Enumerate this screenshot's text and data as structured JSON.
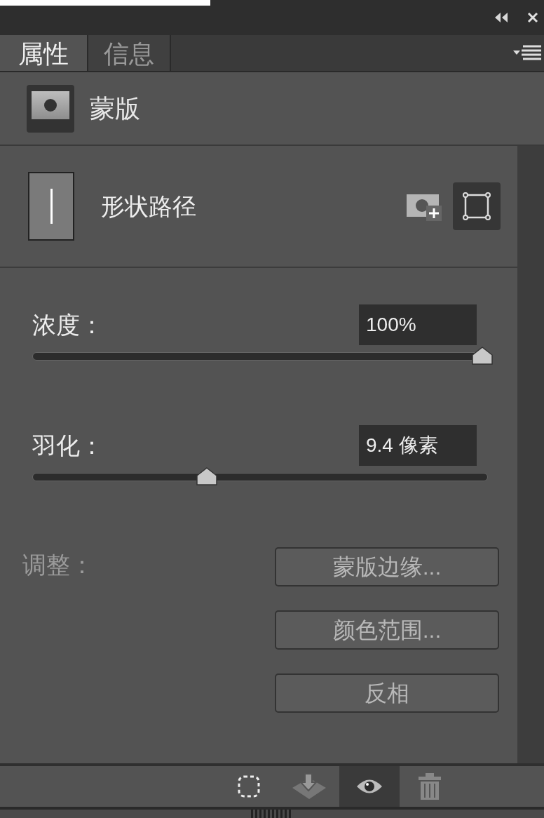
{
  "tabs": [
    {
      "label": "属性",
      "selected": true
    },
    {
      "label": "信息",
      "selected": false
    }
  ],
  "header": {
    "title": "蒙版"
  },
  "shape": {
    "label": "形状路径"
  },
  "sliders": [
    {
      "label": "浓度：",
      "value": "100%",
      "level": 1.0
    },
    {
      "label": "羽化：",
      "value": "9.4 像素",
      "level": 0.38
    }
  ],
  "adjust": {
    "label": "调整：",
    "buttons": [
      "蒙版边缘...",
      "颜色范围...",
      "反相"
    ]
  },
  "tools": [
    {
      "kind": "selection",
      "selected": false
    },
    {
      "kind": "apply",
      "selected": false
    },
    {
      "kind": "visibility",
      "selected": true
    },
    {
      "kind": "delete",
      "selected": false
    }
  ]
}
